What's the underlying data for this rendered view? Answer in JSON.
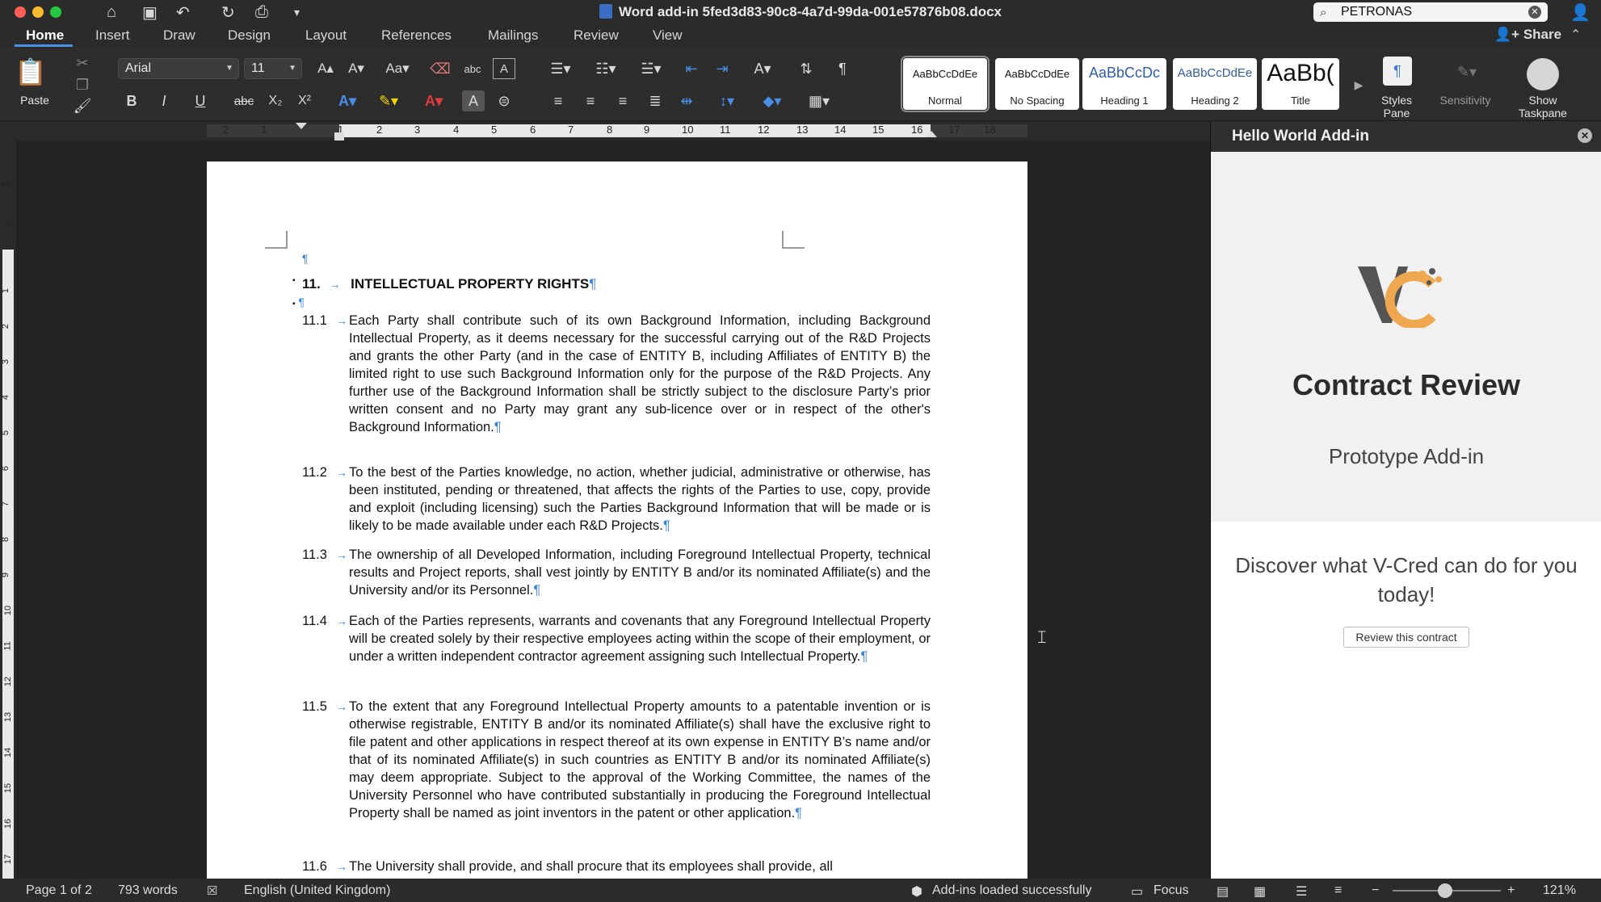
{
  "window": {
    "title": "Word add-in 5fed3d83-90c8-4a7d-99da-001e57876b08.docx",
    "search_value": "PETRONAS"
  },
  "tabs": [
    "Home",
    "Insert",
    "Draw",
    "Design",
    "Layout",
    "References",
    "Mailings",
    "Review",
    "View"
  ],
  "share_label": "Share",
  "ribbon": {
    "paste_label": "Paste",
    "font_name": "Arial",
    "font_size": "11",
    "styles": [
      {
        "sample": "AaBbCcDdEe",
        "label": "Normal"
      },
      {
        "sample": "AaBbCcDdEe",
        "label": "No Spacing"
      },
      {
        "sample": "AaBbCcDc",
        "label": "Heading 1"
      },
      {
        "sample": "AaBbCcDdEe",
        "label": "Heading 2"
      },
      {
        "sample": "AaBb(",
        "label": "Title"
      }
    ],
    "styles_pane_label": "Styles Pane",
    "sensitivity_label": "Sensitivity",
    "show_taskpane_label": "Show Taskpane",
    "btn_bold": "B",
    "btn_italic": "I",
    "btn_underline": "U",
    "btn_strike": "abc",
    "btn_sub": "X₂",
    "btn_sup": "X²",
    "btn_spell": "abc"
  },
  "ruler": {
    "h_labels": [
      "2",
      "1",
      "1",
      "2",
      "3",
      "4",
      "5",
      "6",
      "7",
      "8",
      "9",
      "10",
      "11",
      "12",
      "13",
      "14",
      "15",
      "16",
      "17",
      "18"
    ],
    "v_labels": [
      "2",
      "1",
      "1",
      "2",
      "3",
      "4",
      "5",
      "6",
      "7",
      "8",
      "9",
      "10",
      "11",
      "12",
      "13",
      "14",
      "15",
      "16",
      "17"
    ]
  },
  "document": {
    "empty_mark": "¶",
    "heading_number": "11.",
    "heading_text": "INTELLECTUAL PROPERTY RIGHTS",
    "clauses": [
      {
        "number": "11.1",
        "text": "Each Party shall contribute such of its own Background Information, including Background Intellectual Property, as it deems necessary for the successful carrying out of the R&D Projects and grants the other Party (and in the case of ENTITY B, including Affiliates of ENTITY B) the limited right to use such Background Information only for the purpose of the R&D Projects. Any further use of the Background Information shall be strictly subject to the disclosure Party’s prior written consent and no Party may grant any sub-licence over or in respect of the other's Background Information."
      },
      {
        "number": "11.2",
        "text": "To the best of the Parties knowledge, no action, whether judicial, administrative or otherwise, has been instituted, pending or threatened, that affects the rights of the Parties to use, copy, provide and exploit (including licensing) such the Parties Background Information that will be made or is likely to be made available under each R&D Projects."
      },
      {
        "number": "11.3",
        "text": "The ownership of all Developed Information, including Foreground Intellectual Property, technical results and Project reports, shall vest jointly by ENTITY B and/or its nominated Affiliate(s) and the University and/or its Personnel."
      },
      {
        "number": "11.4",
        "text": "Each of the Parties represents, warrants and covenants that any Foreground Intellectual Property will be created solely by their respective employees acting within the scope of their employment, or under a written independent contractor agreement assigning such Intellectual Property."
      },
      {
        "number": "11.5",
        "text": "To the extent that any Foreground Intellectual Property amounts to a patentable invention or is otherwise registrable, ENTITY B and/or its nominated Affiliate(s) shall have the exclusive right to file patent and other applications in respect thereof at its own expense in ENTITY B’s name and/or that of its nominated Affiliate(s) in such countries as ENTITY B and/or its nominated Affiliate(s) may deem appropriate. Subject to the approval of the Working Committee, the names of the University Personnel who have contributed substantially in producing the Foreground Intellectual Property shall be named as joint inventors in the patent or other application."
      },
      {
        "number": "11.6",
        "text": "The University shall provide, and shall procure that its employees shall provide, all"
      }
    ]
  },
  "pane": {
    "header": "Hello World Add-in",
    "title": "Contract Review",
    "subtitle": "Prototype Add-in",
    "discover": "Discover what V-Cred can do for you today!",
    "button": "Review this contract"
  },
  "status": {
    "page": "Page 1 of 2",
    "words": "793 words",
    "language": "English (United Kingdom)",
    "addins": "Add-ins loaded successfully",
    "focus": "Focus",
    "zoom": "121%"
  }
}
